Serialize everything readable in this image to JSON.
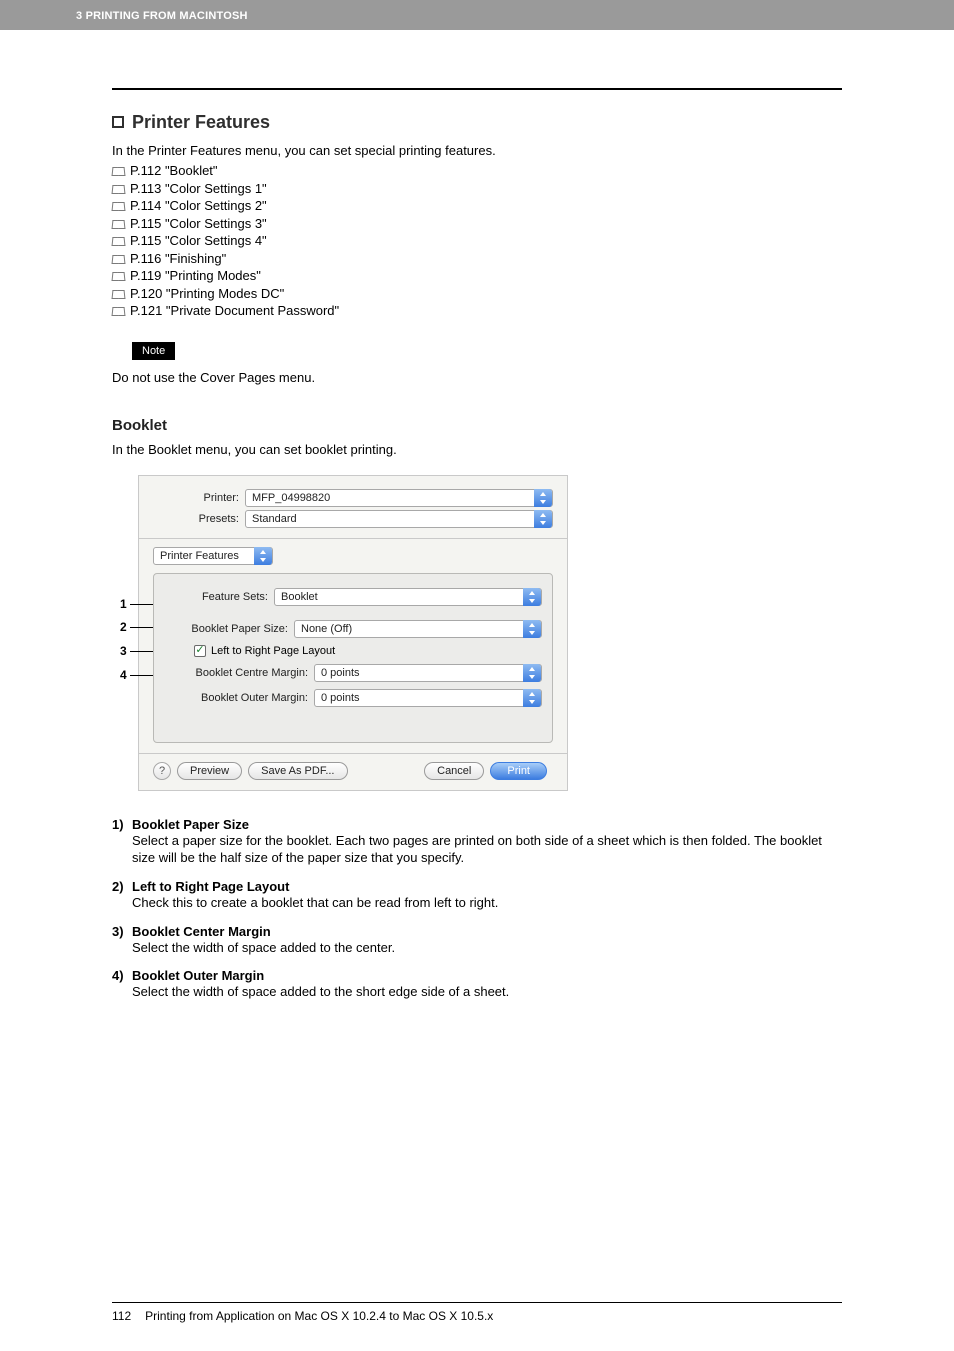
{
  "header": {
    "crumb": "3 PRINTING FROM MACINTOSH"
  },
  "section": {
    "title": "Printer Features",
    "intro": "In the Printer Features menu, you can set special printing features.",
    "refs": [
      "P.112 \"Booklet\"",
      "P.113 \"Color Settings 1\"",
      "P.114 \"Color Settings 2\"",
      "P.115 \"Color Settings 3\"",
      "P.115 \"Color Settings 4\"",
      "P.116 \"Finishing\"",
      "P.119 \"Printing Modes\"",
      "P.120 \"Printing Modes DC\"",
      "P.121 \"Private Document Password\""
    ],
    "note_label": "Note",
    "note_text": "Do not use the Cover Pages menu."
  },
  "subsection": {
    "title": "Booklet",
    "intro": "In the Booklet menu, you can set booklet printing."
  },
  "dialog": {
    "printer_label": "Printer:",
    "printer_value": "MFP_04998820",
    "presets_label": "Presets:",
    "presets_value": "Standard",
    "pane_value": "Printer Features",
    "feature_sets_label": "Feature Sets:",
    "feature_sets_value": "Booklet",
    "opt1_label": "Booklet Paper Size:",
    "opt1_value": "None (Off)",
    "opt2_check": "Left to Right Page Layout",
    "opt3_label": "Booklet Centre Margin:",
    "opt3_value": "0 points",
    "opt4_label": "Booklet Outer Margin:",
    "opt4_value": "0 points",
    "help": "?",
    "preview": "Preview",
    "savepdf": "Save As PDF...",
    "cancel": "Cancel",
    "print": "Print"
  },
  "callouts": {
    "c1": "1",
    "c2": "2",
    "c3": "3",
    "c4": "4"
  },
  "items": [
    {
      "num": "1)",
      "title": "Booklet Paper Size",
      "desc": "Select a paper size for the booklet.  Each two pages are printed on both side of a sheet which is then folded.  The booklet size will be the half size of the paper size that you specify."
    },
    {
      "num": "2)",
      "title": "Left to Right Page Layout",
      "desc": "Check this to create a booklet that can be read from left to right."
    },
    {
      "num": "3)",
      "title": "Booklet Center Margin",
      "desc": "Select the width of space added to the center."
    },
    {
      "num": "4)",
      "title": "Booklet Outer Margin",
      "desc": "Select the width of space added to the short edge side of a sheet."
    }
  ],
  "footer": {
    "page_number": "112",
    "text": "Printing from Application on Mac OS X 10.2.4 to Mac OS X 10.5.x"
  }
}
